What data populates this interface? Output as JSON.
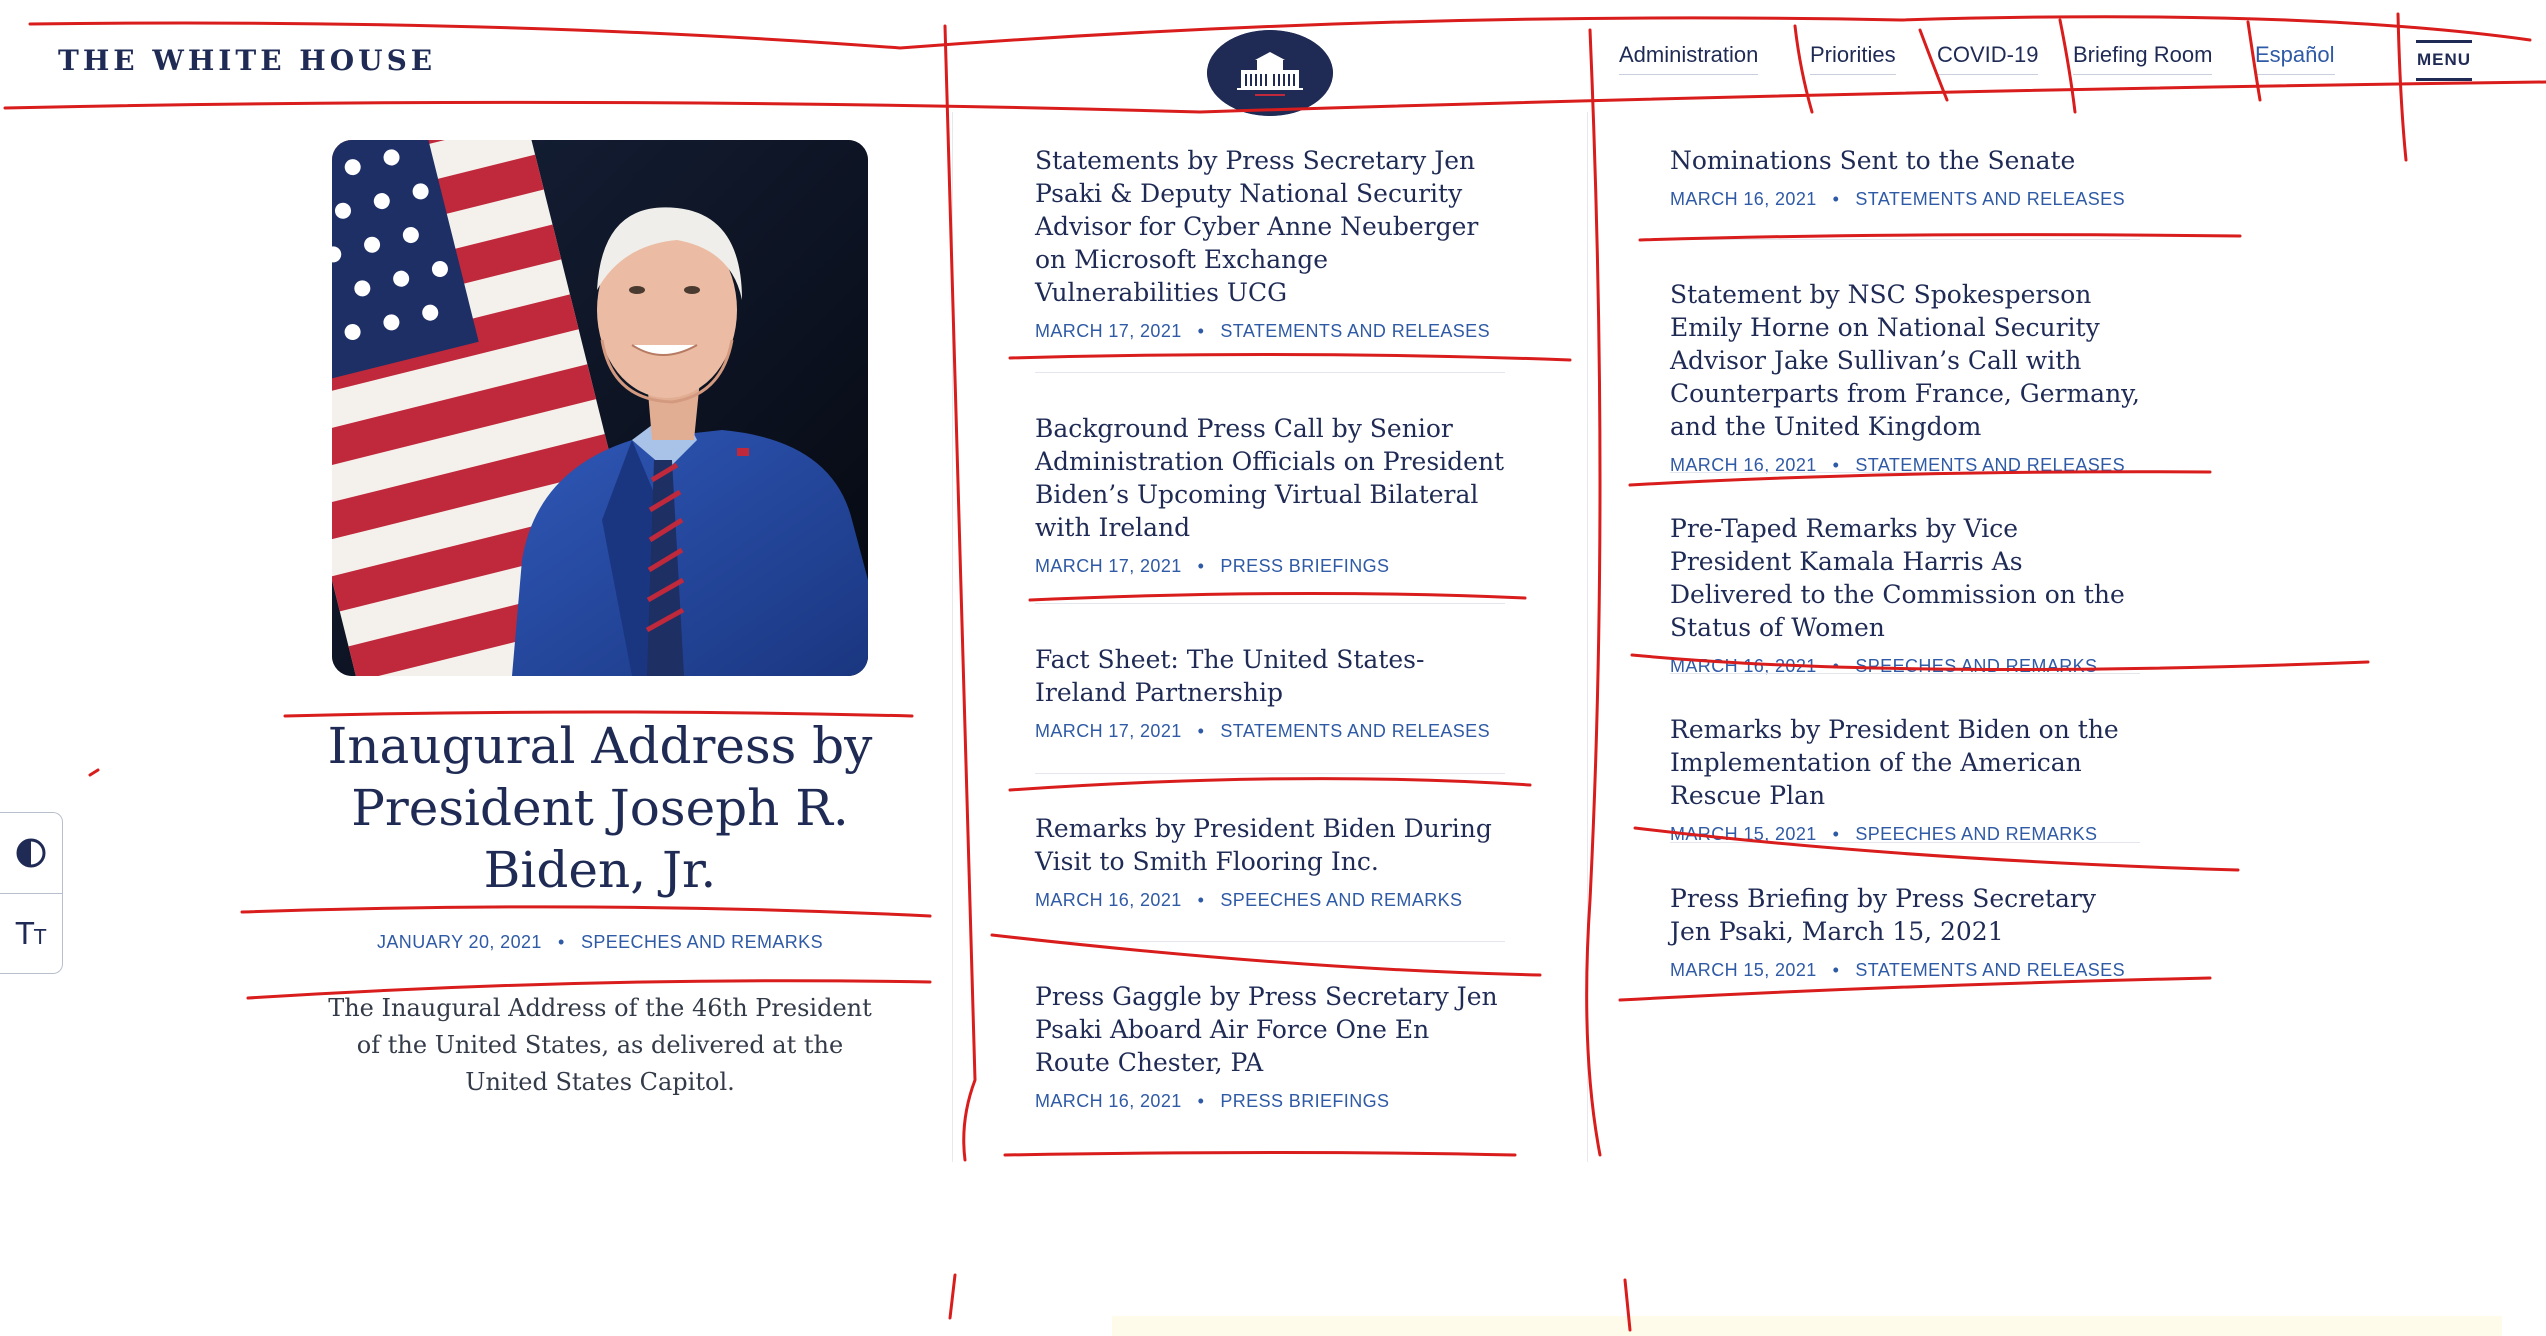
{
  "header": {
    "site_title": "THE WHITE HOUSE",
    "nav": [
      "Administration",
      "Priorities",
      "COVID-19",
      "Briefing Room",
      "Español"
    ],
    "menu_label": "MENU"
  },
  "featured": {
    "title_lines": [
      "Inaugural Address by",
      "President Joseph R.",
      "Biden, Jr."
    ],
    "date": "JANUARY 20, 2021",
    "category": "SPEECHES AND REMARKS",
    "description": "The Inaugural Address of the 46th President of the United States, as delivered at the United States Capitol."
  },
  "tools": {
    "contrast_icon": "contrast-icon",
    "text_size_label": "T",
    "text_size_small": "T"
  },
  "bullet": "•",
  "column_middle": [
    {
      "title": "Statements by Press Secretary Jen Psaki & Deputy National Security Advisor for Cyber Anne Neuberger on Microsoft Exchange Vulnerabilities UCG",
      "date": "MARCH 17, 2021",
      "category": "STATEMENTS AND RELEASES"
    },
    {
      "title": " Background Press Call by Senior Administration Officials on President Biden’s Upcoming Virtual Bilateral with Ireland",
      "date": "MARCH 17, 2021",
      "category": "PRESS BRIEFINGS"
    },
    {
      "title": "Fact Sheet: The United States-Ireland Partnership",
      "date": "MARCH 17, 2021",
      "category": "STATEMENTS AND RELEASES"
    },
    {
      "title": "Remarks by President Biden During Visit to Smith Flooring Inc.",
      "date": "MARCH 16, 2021",
      "category": "SPEECHES AND REMARKS"
    },
    {
      "title": "Press Gaggle by Press Secretary Jen Psaki Aboard Air Force One En Route Chester, PA",
      "date": "MARCH 16, 2021",
      "category": "PRESS BRIEFINGS"
    }
  ],
  "column_right": [
    {
      "title": "Nominations Sent to the Senate",
      "date": "MARCH 16, 2021",
      "category": "STATEMENTS AND RELEASES"
    },
    {
      "title": "Statement by NSC Spokesperson Emily Horne on National Security Advisor Jake Sullivan’s Call with Counterparts from France, Germany, and the United Kingdom",
      "date": "MARCH 16, 2021",
      "category": "STATEMENTS AND RELEASES"
    },
    {
      "title": "Pre-Taped Remarks by Vice President Kamala Harris As Delivered to the Commission on the Status of Women",
      "date": "MARCH 16, 2021",
      "category": "SPEECHES AND REMARKS"
    },
    {
      "title": "Remarks by President Biden on the Implementation of the American Rescue Plan",
      "date": "MARCH 15, 2021",
      "category": "SPEECHES AND REMARKS"
    },
    {
      "title": "Press Briefing by Press Secretary Jen Psaki, March 15, 2021",
      "date": "MARCH 15, 2021",
      "category": "STATEMENTS AND RELEASES"
    }
  ],
  "colors": {
    "navy": "#1f2b55",
    "link_blue": "#2f5aa5",
    "annotation_red": "#d91c1c"
  }
}
